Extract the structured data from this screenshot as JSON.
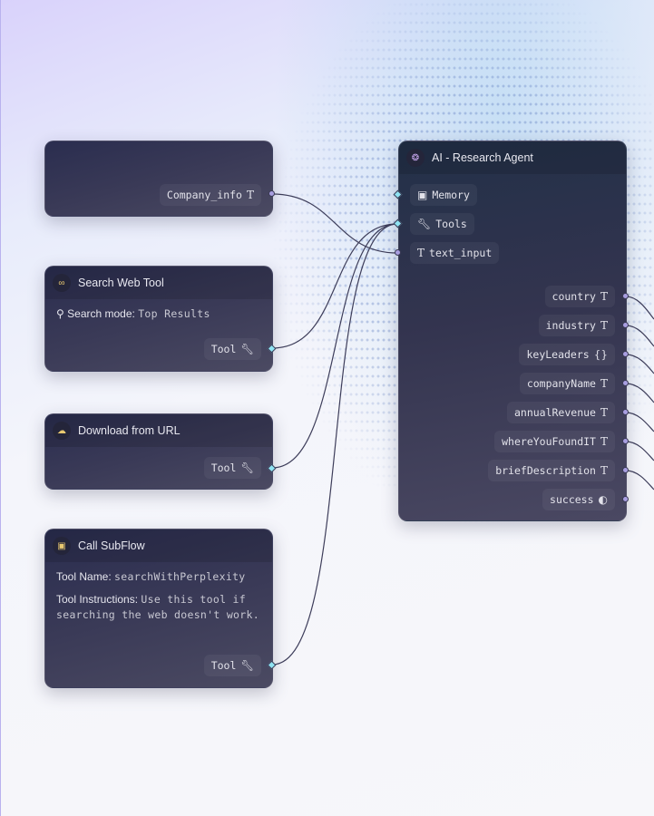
{
  "nodes": {
    "input": {
      "output": "Company_info",
      "output_type_icon": "text-type-icon"
    },
    "search": {
      "title": "Search Web Tool",
      "icon": "binoculars-icon",
      "mode_label": "Search mode:",
      "mode_value": "Top Results",
      "output": "Tool"
    },
    "download": {
      "title": "Download from URL",
      "icon": "cloud-download-icon",
      "output": "Tool"
    },
    "subflow": {
      "title": "Call SubFlow",
      "icon": "robot-icon",
      "name_label": "Tool Name:",
      "name_value": "searchWithPerplexity",
      "instr_label": "Tool Instructions:",
      "instr_value": "Use this tool if searching the web doesn't work.",
      "output": "Tool"
    },
    "agent": {
      "title": "AI - Research Agent",
      "icon": "brain-icon",
      "inputs": [
        {
          "label": "Memory",
          "icon": "chip-icon"
        },
        {
          "label": "Tools",
          "icon": "wrench-icon"
        },
        {
          "label": "text_input",
          "icon": "text-type-icon"
        }
      ],
      "outputs": [
        {
          "label": "country",
          "type": "T"
        },
        {
          "label": "industry",
          "type": "T"
        },
        {
          "label": "keyLeaders",
          "type": "{}"
        },
        {
          "label": "companyName",
          "type": "T"
        },
        {
          "label": "annualRevenue",
          "type": "T"
        },
        {
          "label": "whereYouFoundIT",
          "type": "T"
        },
        {
          "label": "briefDescription",
          "type": "T"
        },
        {
          "label": "success",
          "type": "◐"
        }
      ]
    }
  },
  "colors": {
    "edge": "#3d3d5a",
    "port_data": "#a89ee0",
    "port_tool": "#8fe3f2",
    "node_bg": "#34354f"
  }
}
